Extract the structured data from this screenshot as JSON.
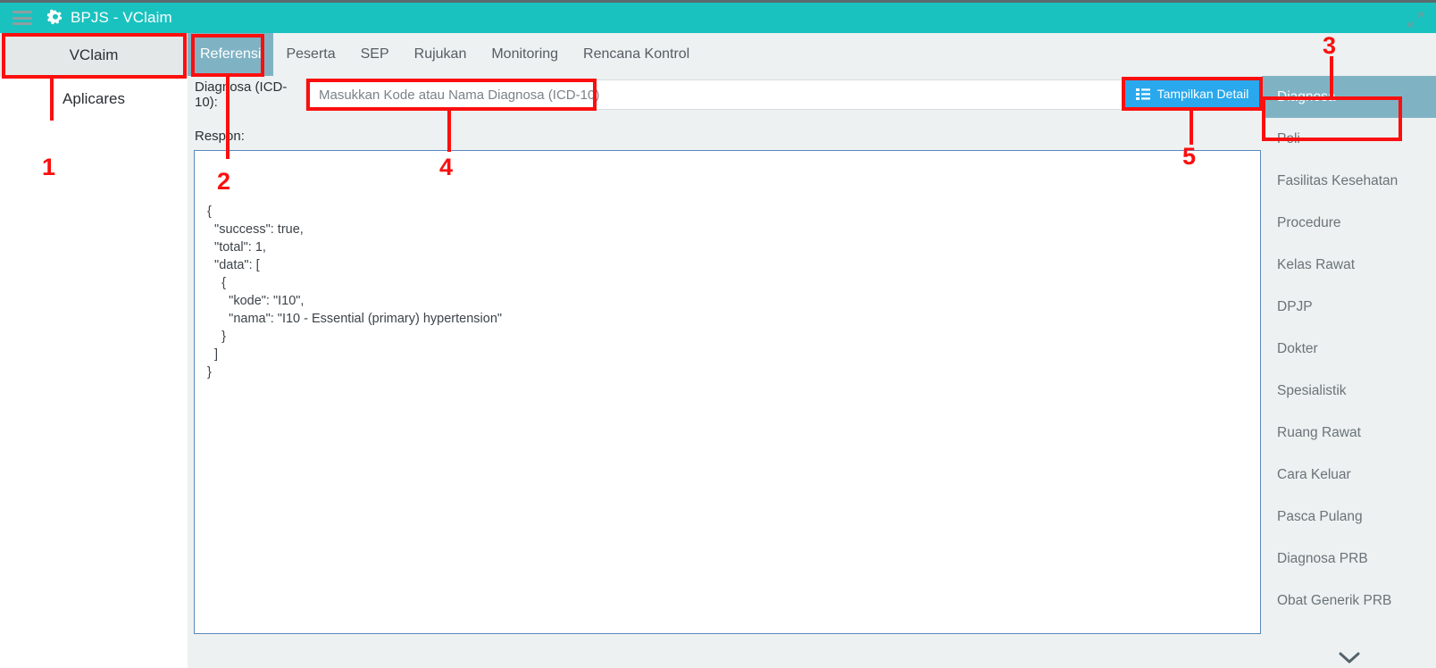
{
  "window": {
    "title": "BPJS - VClaim",
    "menu_icon": "hamburger-icon",
    "brand_icon": "gear-icon",
    "expand_icon": "expand-diagonal-icon"
  },
  "colors": {
    "titlebar": "#1ac2bf",
    "page_bg": "#edf1f1",
    "tab_active": "#7fb3c4",
    "button_primary": "#29a8ed",
    "annotation": "#fb0f0f",
    "respon_border": "#5b88be"
  },
  "left_sidebar": {
    "items": [
      {
        "label": "VClaim",
        "selected": true
      },
      {
        "label": "Aplicares",
        "selected": false
      }
    ]
  },
  "tabs": [
    {
      "label": "Referensi",
      "active": true
    },
    {
      "label": "Peserta",
      "active": false
    },
    {
      "label": "SEP",
      "active": false
    },
    {
      "label": "Rujukan",
      "active": false
    },
    {
      "label": "Monitoring",
      "active": false
    },
    {
      "label": "Rencana Kontrol",
      "active": false
    }
  ],
  "form": {
    "diagnosa_label": "Diagnosa (ICD-10):",
    "diagnosa_placeholder": "Masukkan Kode atau Nama Diagnosa (ICD-10)",
    "diagnosa_value": "",
    "detail_button_label": "Tampilkan Detail",
    "detail_button_icon": "list-icon"
  },
  "respon": {
    "label": "Respon:",
    "body": "{\n  \"success\": true,\n  \"total\": 1,\n  \"data\": [\n    {\n      \"kode\": \"I10\",\n      \"nama\": \"I10 - Essential (primary) hypertension\"\n    }\n  ]\n}"
  },
  "right_sidebar": {
    "items": [
      {
        "label": "Diagnosa",
        "active": true
      },
      {
        "label": "Poli",
        "active": false
      },
      {
        "label": "Fasilitas Kesehatan",
        "active": false
      },
      {
        "label": "Procedure",
        "active": false
      },
      {
        "label": "Kelas Rawat",
        "active": false
      },
      {
        "label": "DPJP",
        "active": false
      },
      {
        "label": "Dokter",
        "active": false
      },
      {
        "label": "Spesialistik",
        "active": false
      },
      {
        "label": "Ruang Rawat",
        "active": false
      },
      {
        "label": "Cara Keluar",
        "active": false
      },
      {
        "label": "Pasca Pulang",
        "active": false
      },
      {
        "label": "Diagnosa PRB",
        "active": false
      },
      {
        "label": "Obat Generik PRB",
        "active": false
      }
    ],
    "scroll_icon": "chevron-down-icon"
  },
  "annotations": [
    {
      "number": "1",
      "target": "left-sidebar-vclaim"
    },
    {
      "number": "2",
      "target": "tab-referensi"
    },
    {
      "number": "3",
      "target": "right-sidebar-diagnosa"
    },
    {
      "number": "4",
      "target": "diagnosa-input"
    },
    {
      "number": "5",
      "target": "tampilkan-detail-button"
    }
  ]
}
